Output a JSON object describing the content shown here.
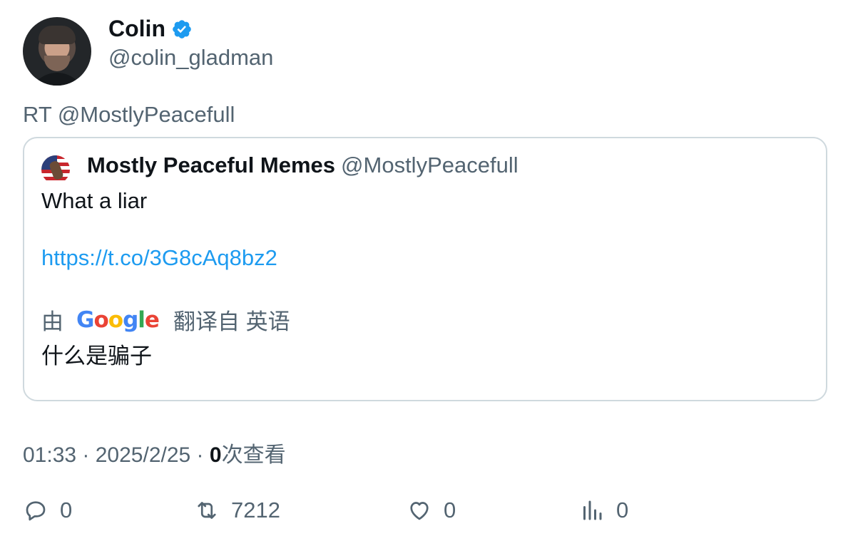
{
  "author": {
    "name": "Colin",
    "handle": "@colin_gladman",
    "verified_icon": "verified-badge-icon",
    "verified_color": "#1d9bf0"
  },
  "tweet": {
    "text": "RT @MostlyPeacefull"
  },
  "quoted": {
    "name": "Mostly Peaceful Memes",
    "handle": "@MostlyPeacefull",
    "text": "What a liar",
    "link": "https://t.co/3G8cAq8bz2",
    "translate_by": "由",
    "translate_brand": "Google",
    "translate_from": "翻译自 英语",
    "translated_text": "什么是骗子"
  },
  "meta": {
    "time": "01:33",
    "sep1": " · ",
    "date": "2025/2/25",
    "sep2": " · ",
    "views_count": "0",
    "views_label": "次查看"
  },
  "actions": {
    "reply_count": "0",
    "retweet_count": "7212",
    "like_count": "0",
    "views_count": "0"
  },
  "colors": {
    "link": "#1d9bf0",
    "secondary_text": "#536471",
    "border": "#cfd9de"
  }
}
